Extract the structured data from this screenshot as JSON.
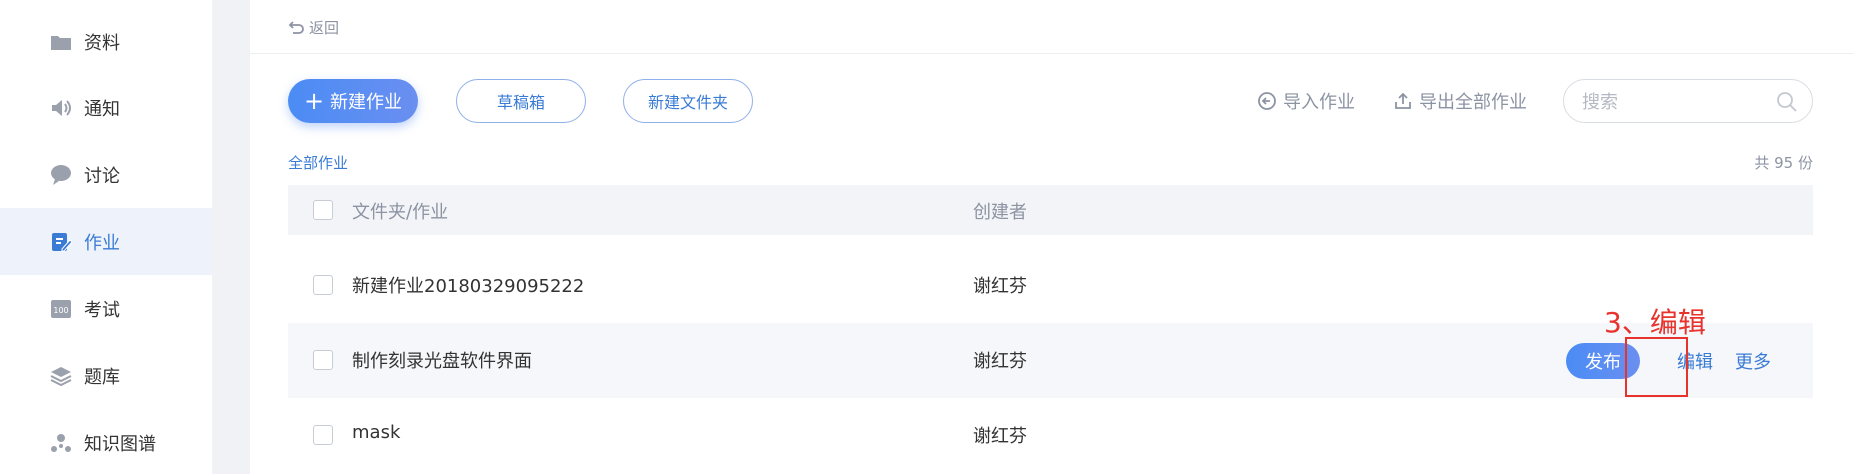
{
  "sidebar": {
    "items": [
      {
        "label": "资料",
        "icon": "folder-icon"
      },
      {
        "label": "通知",
        "icon": "speaker-icon"
      },
      {
        "label": "讨论",
        "icon": "chat-bubble-icon"
      },
      {
        "label": "作业",
        "icon": "edit-document-icon",
        "active": true
      },
      {
        "label": "考试",
        "icon": "exam-score-icon"
      },
      {
        "label": "题库",
        "icon": "layers-icon"
      },
      {
        "label": "知识图谱",
        "icon": "graph-nodes-icon"
      }
    ]
  },
  "header": {
    "back_label": "返回"
  },
  "toolbar": {
    "new_assignment_label": "新建作业",
    "drafts_label": "草稿箱",
    "new_folder_label": "新建文件夹",
    "import_label": "导入作业",
    "export_all_label": "导出全部作业",
    "search_placeholder": "搜索"
  },
  "list": {
    "breadcrumb": "全部作业",
    "total": "共 95 份",
    "columns": {
      "name": "文件夹/作业",
      "creator": "创建者"
    },
    "rows": [
      {
        "name": "新建作业20180329095222",
        "creator": "谢红芬"
      },
      {
        "name": "制作刻录光盘软件界面",
        "creator": "谢红芬"
      },
      {
        "name": "mask",
        "creator": "谢红芬"
      }
    ],
    "row_actions": {
      "publish_label": "发布",
      "edit_label": "编辑",
      "more_label": "更多"
    }
  },
  "annotation": {
    "label": "3、编辑",
    "color": "#e8322c"
  },
  "colors": {
    "accent": "#3a7bd5",
    "sidebar_active_bg": "#eef3fb",
    "muted_text": "#8c93a3"
  }
}
